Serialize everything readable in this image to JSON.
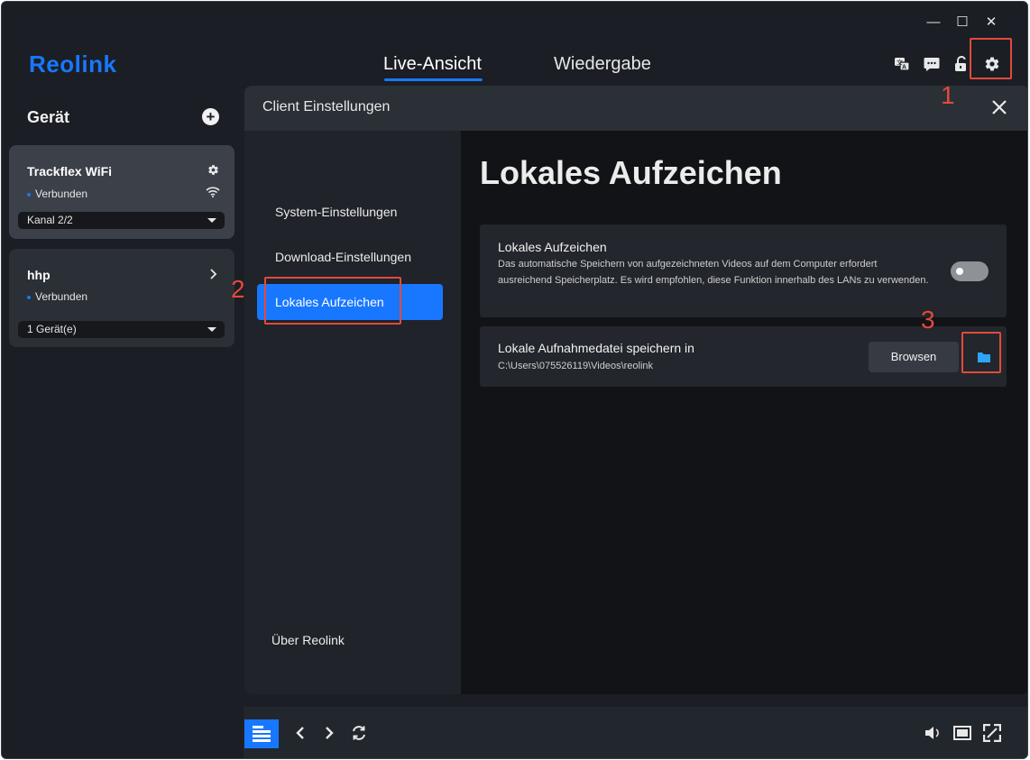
{
  "window": {
    "controls": {
      "minimize": "—",
      "maximize": "☐",
      "close": "✕"
    }
  },
  "header": {
    "logo": "Reolink",
    "tabs": [
      {
        "label": "Live-Ansicht",
        "active": true
      },
      {
        "label": "Wiedergabe",
        "active": false
      }
    ],
    "icons": [
      "translate-icon",
      "message-icon",
      "unlock-icon",
      "gear-icon"
    ]
  },
  "sidebar": {
    "title": "Gerät",
    "devices": [
      {
        "name": "Trackflex WiFi",
        "status": "Verbunden",
        "select": "Kanal 2/2"
      },
      {
        "name": "hhp",
        "status": "Verbunden",
        "select": "1 Gerät(e)"
      }
    ]
  },
  "dialog": {
    "title": "Client Einstellungen",
    "nav": [
      {
        "label": "System-Einstellungen",
        "selected": false
      },
      {
        "label": "Download-Einstellungen",
        "selected": false
      },
      {
        "label": "Lokales Aufzeichen",
        "selected": true
      }
    ],
    "about": "Über Reolink",
    "content_title": "Lokales Aufzeichen",
    "settings": {
      "local_record": {
        "title": "Lokales Aufzeichen",
        "description": "Das automatische Speichern von aufgezeichneten Videos auf dem Computer erfordert ausreichend Speicherplatz. Es wird empfohlen, diese Funktion innerhalb des LANs zu verwenden.",
        "enabled": false
      },
      "save_path": {
        "title": "Lokale Aufnahmedatei speichern in",
        "path": "C:\\Users\\075526119\\Videos\\reolink",
        "browse_label": "Browsen"
      }
    }
  },
  "annotations": [
    "1",
    "2",
    "3"
  ],
  "colors": {
    "accent": "#1877ff",
    "annotation": "#e24a3b",
    "background": "#1b1e24"
  }
}
